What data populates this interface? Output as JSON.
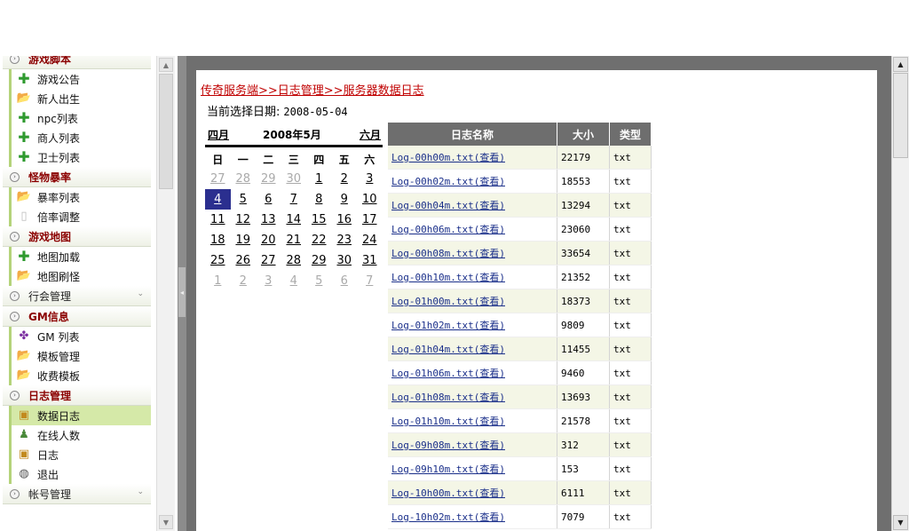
{
  "sidebar": {
    "items": [
      {
        "kind": "section",
        "label": "游戏脚本"
      },
      {
        "kind": "item",
        "icon": "plus-icon",
        "label": "游戏公告"
      },
      {
        "kind": "item",
        "icon": "folder-icon",
        "label": "新人出生"
      },
      {
        "kind": "item",
        "icon": "plus-icon",
        "label": "npc列表"
      },
      {
        "kind": "item",
        "icon": "plus-icon",
        "label": "商人列表"
      },
      {
        "kind": "item",
        "icon": "plus-icon",
        "label": "卫士列表"
      },
      {
        "kind": "section",
        "label": "怪物暴率"
      },
      {
        "kind": "item",
        "icon": "folder-icon",
        "label": "暴率列表"
      },
      {
        "kind": "item",
        "icon": "page-icon",
        "label": "倍率调整"
      },
      {
        "kind": "section",
        "label": "游戏地图"
      },
      {
        "kind": "item",
        "icon": "plus-icon",
        "label": "地图加载"
      },
      {
        "kind": "item",
        "icon": "folder-icon",
        "label": "地图刷怪"
      },
      {
        "kind": "section-plain",
        "label": "行会管理"
      },
      {
        "kind": "section",
        "label": "GM信息"
      },
      {
        "kind": "item",
        "icon": "puzzle-icon",
        "label": "GM 列表"
      },
      {
        "kind": "item",
        "icon": "folder-icon",
        "label": "模板管理"
      },
      {
        "kind": "item",
        "icon": "folder-icon",
        "label": "收费模板"
      },
      {
        "kind": "section",
        "label": "日志管理"
      },
      {
        "kind": "item",
        "icon": "calc-icon",
        "label": "数据日志",
        "selected": true
      },
      {
        "kind": "item",
        "icon": "user-icon",
        "label": "在线人数"
      },
      {
        "kind": "item",
        "icon": "calc-icon",
        "label": "日志"
      },
      {
        "kind": "item",
        "icon": "exit-icon",
        "label": "退出"
      },
      {
        "kind": "section-plain",
        "label": "帐号管理"
      }
    ]
  },
  "main": {
    "breadcrumb": "传奇服务端>>日志管理>>服务器数据日志",
    "date_label": "当前选择日期:",
    "date_value": "2008-05-04",
    "calendar": {
      "prev": "四月",
      "title": "2008年5月",
      "next": "六月",
      "weekdays": [
        "日",
        "一",
        "二",
        "三",
        "四",
        "五",
        "六"
      ],
      "days": [
        {
          "d": "27",
          "other": true
        },
        {
          "d": "28",
          "other": true
        },
        {
          "d": "29",
          "other": true
        },
        {
          "d": "30",
          "other": true
        },
        {
          "d": "1"
        },
        {
          "d": "2"
        },
        {
          "d": "3"
        },
        {
          "d": "4",
          "today": true
        },
        {
          "d": "5"
        },
        {
          "d": "6"
        },
        {
          "d": "7"
        },
        {
          "d": "8"
        },
        {
          "d": "9"
        },
        {
          "d": "10"
        },
        {
          "d": "11"
        },
        {
          "d": "12"
        },
        {
          "d": "13"
        },
        {
          "d": "14"
        },
        {
          "d": "15"
        },
        {
          "d": "16"
        },
        {
          "d": "17"
        },
        {
          "d": "18"
        },
        {
          "d": "19"
        },
        {
          "d": "20"
        },
        {
          "d": "21"
        },
        {
          "d": "22"
        },
        {
          "d": "23"
        },
        {
          "d": "24"
        },
        {
          "d": "25"
        },
        {
          "d": "26"
        },
        {
          "d": "27"
        },
        {
          "d": "28"
        },
        {
          "d": "29"
        },
        {
          "d": "30"
        },
        {
          "d": "31"
        },
        {
          "d": "1",
          "other": true
        },
        {
          "d": "2",
          "other": true
        },
        {
          "d": "3",
          "other": true
        },
        {
          "d": "4",
          "other": true
        },
        {
          "d": "5",
          "other": true
        },
        {
          "d": "6",
          "other": true
        },
        {
          "d": "7",
          "other": true
        }
      ]
    },
    "table": {
      "headers": {
        "name": "日志名称",
        "size": "大小",
        "type": "类型"
      },
      "rows": [
        {
          "name": "Log-00h00m.txt(查看)",
          "size": "22179",
          "type": "txt"
        },
        {
          "name": "Log-00h02m.txt(查看)",
          "size": "18553",
          "type": "txt"
        },
        {
          "name": "Log-00h04m.txt(查看)",
          "size": "13294",
          "type": "txt"
        },
        {
          "name": "Log-00h06m.txt(查看)",
          "size": "23060",
          "type": "txt"
        },
        {
          "name": "Log-00h08m.txt(查看)",
          "size": "33654",
          "type": "txt"
        },
        {
          "name": "Log-00h10m.txt(查看)",
          "size": "21352",
          "type": "txt"
        },
        {
          "name": "Log-01h00m.txt(查看)",
          "size": "18373",
          "type": "txt"
        },
        {
          "name": "Log-01h02m.txt(查看)",
          "size": "9809",
          "type": "txt"
        },
        {
          "name": "Log-01h04m.txt(查看)",
          "size": "11455",
          "type": "txt"
        },
        {
          "name": "Log-01h06m.txt(查看)",
          "size": "9460",
          "type": "txt"
        },
        {
          "name": "Log-01h08m.txt(查看)",
          "size": "13693",
          "type": "txt"
        },
        {
          "name": "Log-01h10m.txt(查看)",
          "size": "21578",
          "type": "txt"
        },
        {
          "name": "Log-09h08m.txt(查看)",
          "size": "312",
          "type": "txt"
        },
        {
          "name": "Log-09h10m.txt(查看)",
          "size": "153",
          "type": "txt"
        },
        {
          "name": "Log-10h00m.txt(查看)",
          "size": "6111",
          "type": "txt"
        },
        {
          "name": "Log-10h02m.txt(查看)",
          "size": "7079",
          "type": "txt"
        }
      ]
    }
  },
  "colors": {
    "accent": "#2b2f8f",
    "section_text": "#8b0000",
    "breadcrumb": "#c00000",
    "selected_item": "#d5e9a8"
  }
}
